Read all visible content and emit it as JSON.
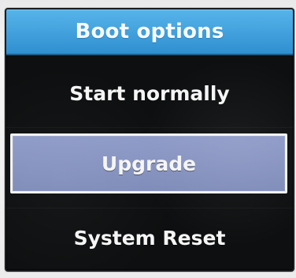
{
  "dialog": {
    "title": "Boot options",
    "items": [
      {
        "label": "Start normally"
      },
      {
        "label": "Upgrade",
        "selected": true
      },
      {
        "label": "System Reset"
      }
    ]
  },
  "colors": {
    "title_bar": "#2f8fd0",
    "screen_background": "#0d0f10",
    "selected_background": "#8794c0",
    "selected_border": "#f2f2f2",
    "text": "#f5f5f5"
  }
}
